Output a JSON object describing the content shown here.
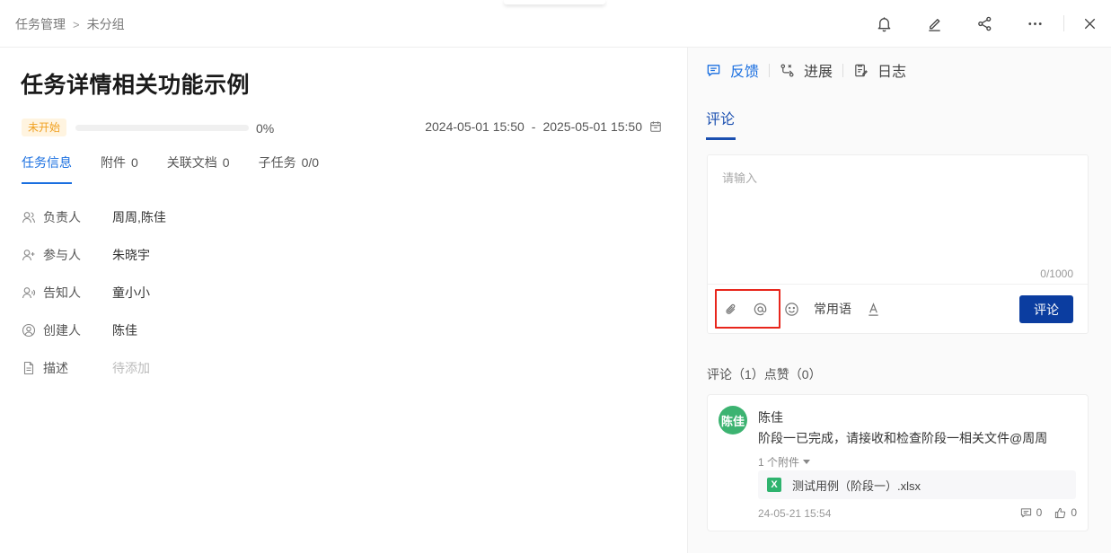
{
  "breadcrumb": {
    "root": "任务管理",
    "separator": ">",
    "current": "未分组"
  },
  "header": {
    "actions": [
      "bell-icon",
      "edit-icon",
      "share-icon",
      "more-icon",
      "close-icon"
    ]
  },
  "task": {
    "title": "任务详情相关功能示例",
    "status": "未开始",
    "progress_percent": 0,
    "progress_text": "0%",
    "start": "2024-05-01 15:50",
    "range_sep": "-",
    "end": "2025-05-01 15:50"
  },
  "tabs": [
    {
      "label": "任务信息",
      "count": ""
    },
    {
      "label": "附件",
      "count": "0"
    },
    {
      "label": "关联文档",
      "count": "0"
    },
    {
      "label": "子任务",
      "count": "0/0"
    }
  ],
  "fields": [
    {
      "label": "负责人",
      "value": "周周,陈佳",
      "icon": "owner-icon"
    },
    {
      "label": "参与人",
      "value": "朱晓宇",
      "icon": "participant-icon"
    },
    {
      "label": "告知人",
      "value": "童小小",
      "icon": "notify-icon"
    },
    {
      "label": "创建人",
      "value": "陈佳",
      "icon": "creator-icon"
    },
    {
      "label": "描述",
      "value": "待添加",
      "icon": "description-icon"
    }
  ],
  "right_tabs": [
    {
      "label": "反馈",
      "icon": "feedback-icon"
    },
    {
      "label": "进展",
      "icon": "progress-icon"
    },
    {
      "label": "日志",
      "icon": "log-icon"
    }
  ],
  "comments": {
    "heading": "评论",
    "placeholder": "请输入",
    "counter": "0/1000",
    "phrases_label": "常用语",
    "submit_label": "评论",
    "stats": "评论（1）点赞（0）"
  },
  "comment": {
    "avatar_text": "陈佳",
    "author": "陈佳",
    "text": "阶段一已完成，请接收和检查阶段一相关文件@周周",
    "attach_toggle": "1 个附件",
    "file_icon_letter": "X",
    "file_name": "测试用例（阶段一）.xlsx",
    "time": "24-05-21 15:54",
    "reply_count": "0",
    "like_count": "0"
  },
  "colors": {
    "accent": "#1a6fe0",
    "primary_button": "#0b3da0",
    "status_text": "#f0a020",
    "status_bg": "#fff4e0",
    "avatar": "#3cb371",
    "highlight": "#e8261c"
  }
}
